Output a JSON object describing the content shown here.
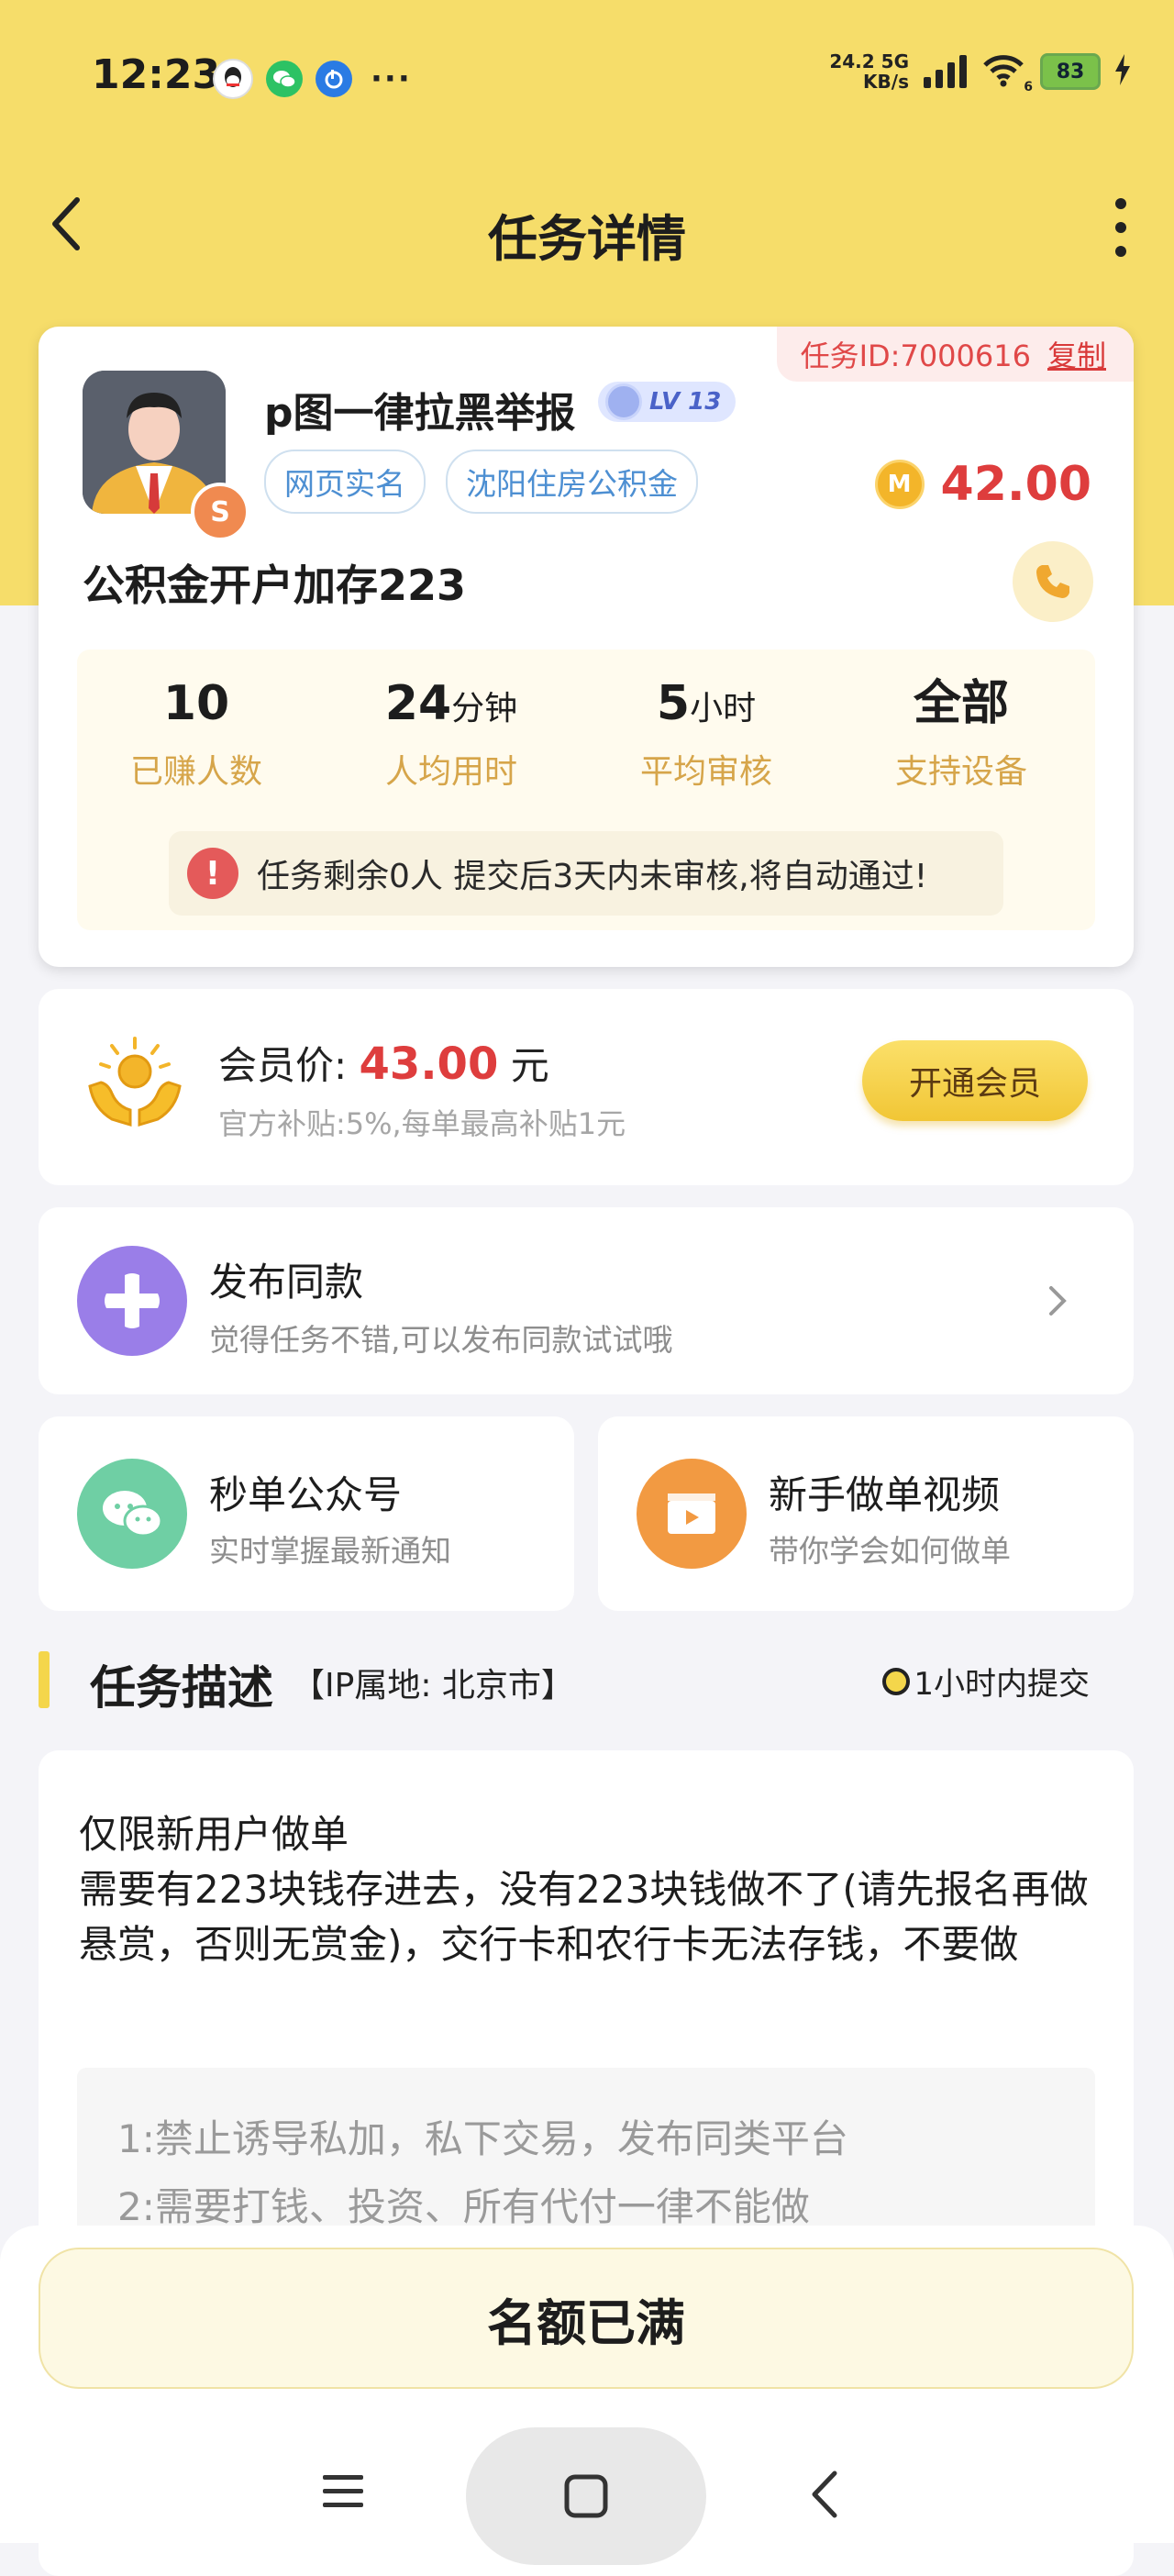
{
  "status_bar": {
    "time": "12:23",
    "net_speed_value": "24.2",
    "net_speed_unit": "KB/s",
    "network_type": "5G",
    "wifi_level": "6",
    "battery": "83",
    "icons": [
      "qq-icon",
      "wechat-icon",
      "blue-app-icon",
      "more-dots-icon",
      "signal-icon",
      "wifi-icon",
      "battery-icon",
      "charging-icon"
    ]
  },
  "header": {
    "title": "任务详情"
  },
  "task": {
    "id_label": "任务ID:7000616",
    "copy_label": "复制",
    "publisher_name": "p图一律拉黑举报",
    "level": "LV 13",
    "tags": [
      "网页实名",
      "沈阳住房公积金"
    ],
    "reward": "42.00",
    "coin_letter": "M",
    "badge_letter": "S",
    "title": "公积金开户加存223"
  },
  "stats": [
    {
      "value": "10",
      "unit": "",
      "label": "已赚人数"
    },
    {
      "value": "24",
      "unit": "分钟",
      "label": "人均用时"
    },
    {
      "value": "5",
      "unit": "小时",
      "label": "平均审核"
    },
    {
      "value": "全部",
      "unit": "",
      "label": "支持设备"
    }
  ],
  "notice": "任务剩余0人  提交后3天内未审核,将自动通过!",
  "vip": {
    "label": "会员价: ",
    "price": "43.00",
    "unit": " 元",
    "subsidy": "官方补贴:5%,每单最高补贴1元",
    "button": "开通会员"
  },
  "publish_same": {
    "title": "发布同款",
    "subtitle": "觉得任务不错,可以发布同款试试哦"
  },
  "quick_links": [
    {
      "title": "秒单公众号",
      "subtitle": "实时掌握最新通知"
    },
    {
      "title": "新手做单视频",
      "subtitle": "带你学会如何做单"
    }
  ],
  "description": {
    "heading": "任务描述",
    "ip": "【IP属地: 北京市】",
    "deadline": "1小时内提交",
    "lines": [
      "仅限新用户做单",
      "需要有223块钱存进去，没有223块钱做不了(请先报名再做悬赏，否则无赏金)，交行卡和农行卡无法存钱，不要做"
    ],
    "rules": [
      "1:禁止诱导私加，私下交易，发布同类平台",
      "2:需要打钱、投资、所有代付一律不能做"
    ]
  },
  "bottom": {
    "button": "名额已满"
  },
  "colors": {
    "header_yellow": "#f6dd6a",
    "price_red": "#de3d3d",
    "stat_label_gold": "#d6a54a",
    "tag_blue": "#4d8fd2",
    "publish_purple": "#9a7ee8",
    "wechat_green": "#6fcfa4",
    "video_orange": "#f29a42"
  }
}
